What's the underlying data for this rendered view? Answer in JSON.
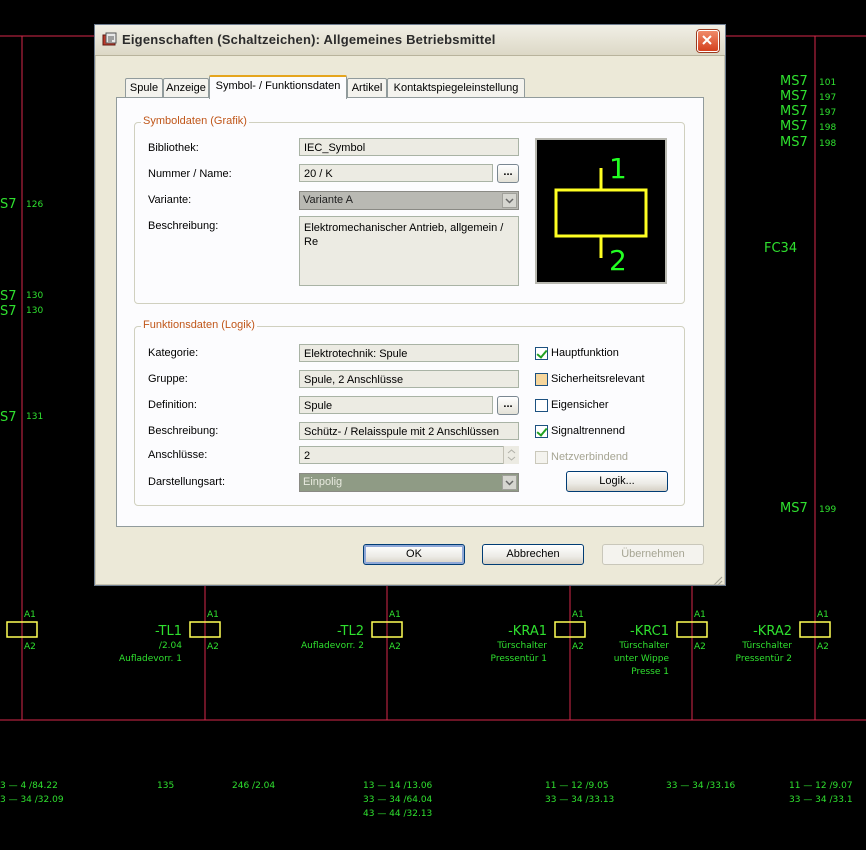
{
  "window": {
    "title": "Eigenschaften (Schaltzeichen): Allgemeines Betriebsmittel"
  },
  "tabs": [
    "Spule",
    "Anzeige",
    "Symbol- / Funktionsdaten",
    "Artikel",
    "Kontaktspiegeleinstellung"
  ],
  "active_tab": "Symbol- / Funktionsdaten",
  "symbol_group": {
    "title": "Symboldaten (Grafik)",
    "bibliothek_label": "Bibliothek:",
    "bibliothek_value": "IEC_Symbol",
    "nummer_label": "Nummer / Name:",
    "nummer_value": "20 / K",
    "dots": "...",
    "variante_label": "Variante:",
    "variante_value": "Variante A",
    "beschreibung_label": "Beschreibung:",
    "beschreibung_value": "Elektromechanischer Antrieb, allgemein / Re",
    "preview_top": "1",
    "preview_bottom": "2"
  },
  "function_group": {
    "title": "Funktionsdaten (Logik)",
    "kategorie_label": "Kategorie:",
    "kategorie_value": "Elektrotechnik: Spule",
    "gruppe_label": "Gruppe:",
    "gruppe_value": "Spule, 2 Anschlüsse",
    "definition_label": "Definition:",
    "definition_value": "Spule",
    "beschreibung_label": "Beschreibung:",
    "beschreibung_value": "Schütz- / Relaisspule mit 2 Anschlüssen",
    "anschluesse_label": "Anschlüsse:",
    "anschluesse_value": "2",
    "darstellung_label": "Darstellungsart:",
    "darstellung_value": "Einpolig",
    "checkboxes": [
      {
        "label": "Hauptfunktion",
        "state": "checked"
      },
      {
        "label": "Sicherheitsrelevant",
        "state": "partial"
      },
      {
        "label": "Eigensicher",
        "state": "unchecked"
      },
      {
        "label": "Signaltrennend",
        "state": "checked"
      },
      {
        "label": "Netzverbindend",
        "state": "disabled"
      }
    ],
    "logik_button": "Logik..."
  },
  "buttons": {
    "ok": "OK",
    "cancel": "Abbrechen",
    "apply": "Übernehmen"
  },
  "schematic": {
    "ms7_right": [
      "MS7",
      "MS7",
      "MS7",
      "MS7",
      "MS7"
    ],
    "ms7_right_refs": [
      "101",
      "197",
      "197",
      "198",
      "198"
    ],
    "ms7_left": [
      "S7",
      "S7",
      "S7",
      "S7"
    ],
    "ms7_left_refs": [
      "126",
      "130",
      "130",
      "131"
    ],
    "fc34": "FC34",
    "ms7_199": "MS7",
    "ms7_199_ref": "199",
    "coil_terms": [
      "A1",
      "A2"
    ],
    "devices": [
      {
        "tag": "-TL1",
        "line1": "/2.04",
        "line2": "Aufladevorr. 1",
        "line3": ""
      },
      {
        "tag": "-TL2",
        "line1": "Aufladevorr. 2",
        "line2": "",
        "line3": ""
      },
      {
        "tag": "-KRA1",
        "line1": "Türschalter",
        "line2": "Pressentür 1",
        "line3": ""
      },
      {
        "tag": "-KRC1",
        "line1": "Türschalter",
        "line2": "unter Wippe",
        "line3": "Presse 1"
      },
      {
        "tag": "-KRA2",
        "line1": "Türschalter",
        "line2": "Pressentür 2",
        "line3": ""
      }
    ],
    "contact_rows": [
      "3 — 4 /84.22",
      "3 — 34 /32.09",
      "135",
      "246 /2.04",
      "13 — 14 /13.06",
      "33 — 34 /64.04",
      "43 — 44 /32.13",
      "11 — 12 /9.05",
      "33 — 34 /33.13",
      "33 — 34 /33.16",
      "11 — 12 /9.07",
      "33 — 34 /33.1"
    ]
  }
}
